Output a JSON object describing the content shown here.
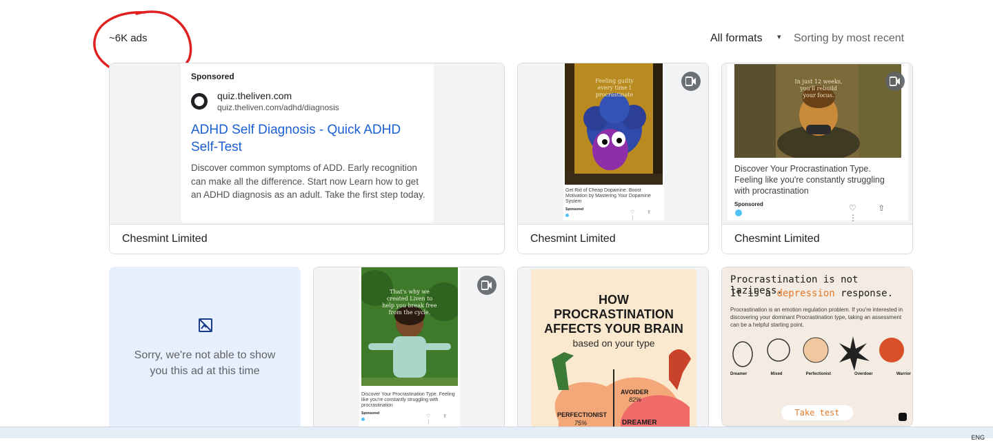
{
  "header": {
    "ad_count": "~6K ads",
    "formats_label": "All formats",
    "formats_caret": "▾",
    "sorting_label": "Sorting by most recent"
  },
  "cards": [
    {
      "advertiser": "Chesmint Limited",
      "type": "text-ad",
      "sponsored": "Sponsored",
      "domain": "quiz.theliven.com",
      "url": "quiz.theliven.com/adhd/diagnosis",
      "headline": "ADHD Self Diagnosis - Quick ADHD Self-Test",
      "description": "Discover common symptoms of ADD. Early recognition can make all the difference. Start now Learn how to get an ADHD diagnosis as an adult. Take the first step today."
    },
    {
      "advertiser": "Chesmint Limited",
      "type": "video",
      "image_text": "Feeling guilty every time I procrastinate",
      "caption": "Get Rid of Cheap Dopamine. Boost Motivation by Mastering Your Dopamine System",
      "sponsored": "Sponsored",
      "icons": "♡ ⇧ ⋮"
    },
    {
      "advertiser": "Chesmint Limited",
      "type": "video",
      "image_text": "In just 12 weeks, you'll rebuild your focus.",
      "caption": "Discover Your Procrastination Type. Feeling like you're constantly struggling with procrastination",
      "sponsored": "Sponsored",
      "icons": "♡ ⇧ ⋮"
    },
    {
      "type": "unavailable",
      "message_line1": "Sorry, we're not able to show",
      "message_line2": "you this ad at this time"
    },
    {
      "type": "video",
      "image_text": "That's why we created Liven to help you break free from the cycle.",
      "caption": "Discover Your Procrastination Type. Feeling like you're constantly struggling with procrastination",
      "sponsored": "Sponsored",
      "icons": "♡ ⇧ ⋮"
    },
    {
      "type": "image",
      "title_line1": "HOW",
      "title_line2": "PROCRASTINATION",
      "title_line3": "AFFECTS YOUR BRAIN",
      "subtitle": "based on your type",
      "label_avoider": "AVOIDER",
      "value_avoider": "82%",
      "label_perfectionist": "PERFECTIONIST",
      "value_perfectionist": "75%",
      "label_dreamer": "DREAMER"
    },
    {
      "type": "image",
      "title_line1": "Procrastination is not laziness.",
      "title_line2_a": "It is a ",
      "title_line2_b": "depression",
      "title_line2_c": " response.",
      "body": "Procrastination is an emotion regulation problem. If you're interested in discovering your dominant Procrastination type, taking an assessment can be a helpful starting point.",
      "types": [
        "Dreamer",
        "Mixed",
        "Perfectionist",
        "Overdoer",
        "Warrior"
      ],
      "button": "Take test"
    }
  ],
  "taskbar": {
    "lang": "ENG"
  },
  "colors": {
    "link": "#1a5fd6",
    "annotation": "#e02020",
    "unavailable_bg": "#e8f0fe"
  }
}
